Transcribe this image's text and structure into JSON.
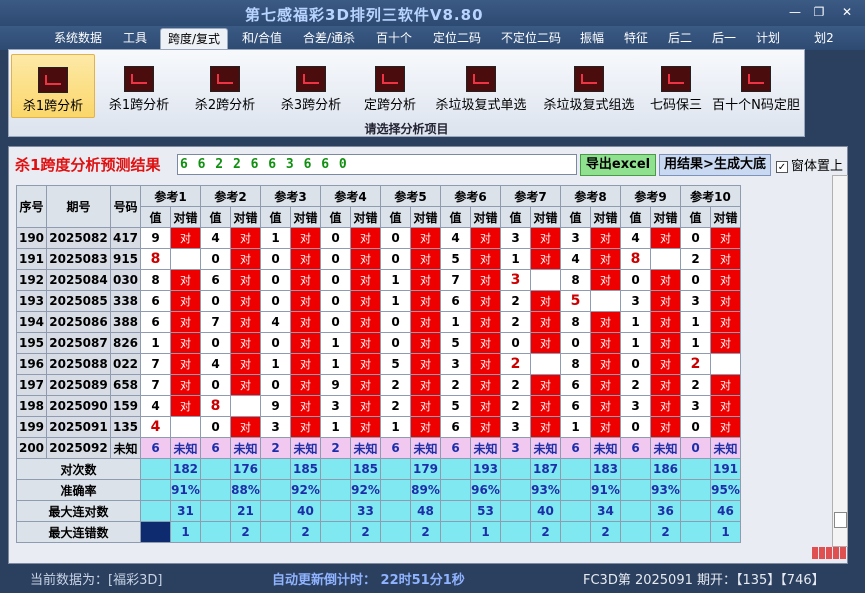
{
  "window": {
    "title": "第七感福彩3D排列三软件V8.80",
    "min": "—",
    "restore": "❐",
    "close": "✕"
  },
  "menu": [
    "系统数据",
    "工具",
    "跨度/复式",
    "和/合值",
    "合差/通杀",
    "百十个",
    "定位二码",
    "不定位二码",
    "振幅",
    "特征",
    "后二",
    "后一",
    "计划",
    "划2"
  ],
  "ribbon": {
    "buttons": [
      "杀1跨分析",
      "杀1跨分析",
      "杀2跨分析",
      "杀3跨分析",
      "定跨分析",
      "杀垃圾复式单选",
      "杀垃圾复式组选",
      "七码保三",
      "百十个N码定胆"
    ],
    "caption": "请选择分析项目"
  },
  "result": {
    "label": "杀1跨度分析预测结果",
    "value": "6 6 2 2 6 6 3 6 6 0",
    "excel_button": "导出excel",
    "generate_button": "用结果>生成大底",
    "topmost_label": "窗体置上",
    "topmost_checked": "✓"
  },
  "table": {
    "headers": {
      "seq": "序号",
      "issue": "期号",
      "number": "号码",
      "value": "值",
      "judge": "对错"
    },
    "ref_headers": [
      "参考1",
      "参考2",
      "参考3",
      "参考4",
      "参考5",
      "参考6",
      "参考7",
      "参考8",
      "参考9",
      "参考10"
    ],
    "rows": [
      {
        "seq": "190",
        "issue": "2025082",
        "num": "417",
        "vals": [
          "9",
          "4",
          "1",
          "0",
          "0",
          "4",
          "3",
          "3",
          "4",
          "0"
        ],
        "hit": [
          1,
          1,
          1,
          1,
          1,
          1,
          1,
          1,
          1,
          1
        ]
      },
      {
        "seq": "191",
        "issue": "2025083",
        "num": "915",
        "vals": [
          "8",
          "0",
          "0",
          "0",
          "0",
          "5",
          "1",
          "4",
          "8",
          "2"
        ],
        "hit": [
          0,
          1,
          1,
          1,
          1,
          1,
          1,
          1,
          0,
          1
        ]
      },
      {
        "seq": "192",
        "issue": "2025084",
        "num": "030",
        "vals": [
          "8",
          "6",
          "0",
          "0",
          "1",
          "7",
          "3",
          "8",
          "0",
          "0"
        ],
        "hit": [
          1,
          1,
          1,
          1,
          1,
          1,
          0,
          1,
          1,
          1
        ]
      },
      {
        "seq": "193",
        "issue": "2025085",
        "num": "338",
        "vals": [
          "6",
          "0",
          "0",
          "0",
          "1",
          "6",
          "2",
          "5",
          "3",
          "3"
        ],
        "hit": [
          1,
          1,
          1,
          1,
          1,
          1,
          1,
          0,
          1,
          1
        ]
      },
      {
        "seq": "194",
        "issue": "2025086",
        "num": "388",
        "vals": [
          "6",
          "7",
          "4",
          "0",
          "0",
          "1",
          "2",
          "8",
          "1",
          "1"
        ],
        "hit": [
          1,
          1,
          1,
          1,
          1,
          1,
          1,
          1,
          1,
          1
        ]
      },
      {
        "seq": "195",
        "issue": "2025087",
        "num": "826",
        "vals": [
          "1",
          "0",
          "0",
          "1",
          "0",
          "5",
          "0",
          "0",
          "1",
          "1"
        ],
        "hit": [
          1,
          1,
          1,
          1,
          1,
          1,
          1,
          1,
          1,
          1
        ]
      },
      {
        "seq": "196",
        "issue": "2025088",
        "num": "022",
        "vals": [
          "7",
          "4",
          "1",
          "1",
          "5",
          "3",
          "2",
          "8",
          "0",
          "2"
        ],
        "hit": [
          1,
          1,
          1,
          1,
          1,
          1,
          0,
          1,
          1,
          0
        ]
      },
      {
        "seq": "197",
        "issue": "2025089",
        "num": "658",
        "vals": [
          "7",
          "0",
          "0",
          "9",
          "2",
          "2",
          "2",
          "6",
          "2",
          "2"
        ],
        "hit": [
          1,
          1,
          1,
          1,
          1,
          1,
          1,
          1,
          1,
          1
        ]
      },
      {
        "seq": "198",
        "issue": "2025090",
        "num": "159",
        "vals": [
          "4",
          "8",
          "9",
          "3",
          "2",
          "5",
          "2",
          "6",
          "3",
          "3"
        ],
        "hit": [
          1,
          0,
          1,
          1,
          1,
          1,
          1,
          1,
          1,
          1
        ]
      },
      {
        "seq": "199",
        "issue": "2025091",
        "num": "135",
        "vals": [
          "4",
          "0",
          "3",
          "1",
          "1",
          "6",
          "3",
          "1",
          "0",
          "0"
        ],
        "hit": [
          0,
          1,
          1,
          1,
          1,
          1,
          1,
          1,
          1,
          1
        ]
      },
      {
        "seq": "200",
        "issue": "2025092",
        "num": "未知",
        "vals": [
          "6",
          "6",
          "2",
          "2",
          "6",
          "6",
          "3",
          "6",
          "6",
          "0"
        ],
        "hit": [
          2,
          2,
          2,
          2,
          2,
          2,
          2,
          2,
          2,
          2
        ]
      }
    ],
    "hit_text": "对",
    "unknown_text": "未知",
    "stats": [
      {
        "label": "对次数",
        "vals": [
          "182",
          "176",
          "185",
          "185",
          "179",
          "193",
          "187",
          "183",
          "186",
          "191"
        ]
      },
      {
        "label": "准确率",
        "vals": [
          "91%",
          "88%",
          "92%",
          "92%",
          "89%",
          "96%",
          "93%",
          "91%",
          "93%",
          "95%"
        ]
      },
      {
        "label": "最大连对数",
        "vals": [
          "31",
          "21",
          "40",
          "33",
          "48",
          "53",
          "40",
          "34",
          "36",
          "46"
        ]
      },
      {
        "label": "最大连错数",
        "vals": [
          "1",
          "2",
          "2",
          "2",
          "2",
          "1",
          "2",
          "2",
          "2",
          "1"
        ]
      }
    ]
  },
  "status": {
    "current_data": "当前数据为：[福彩3D]",
    "countdown": "自动更新倒计时：  22时51分1秒",
    "issue_info": "FC3D第 2025091 期开：【135】【746】"
  },
  "colors": {
    "hit_red": "#ee0000",
    "accent_blue": "#1d2fa8",
    "stat_cyan": "#7fe8f0",
    "unknown_pink": "#f0c8f0"
  }
}
